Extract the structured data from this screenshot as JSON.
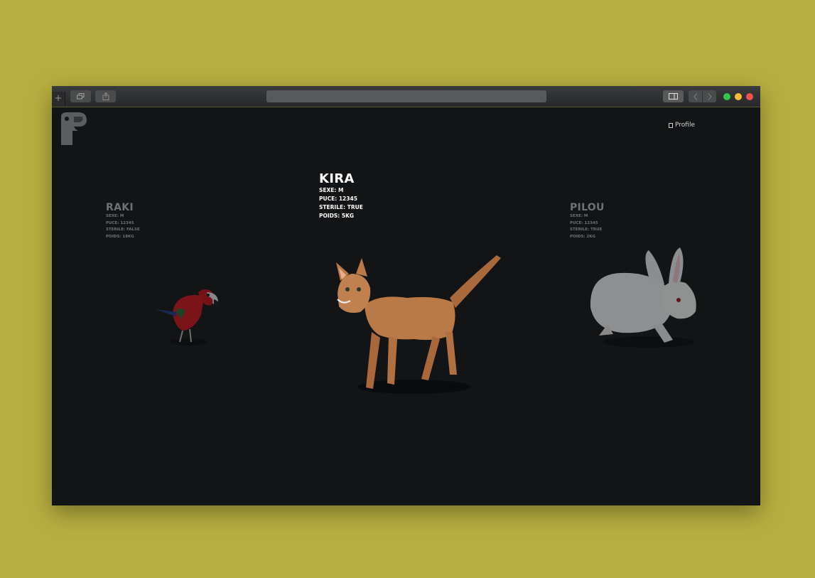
{
  "browser": {
    "new_tab_label": "+",
    "tabs_icon": "tabs-icon",
    "share_icon": "share-icon",
    "sidebar_icon": "sidebar-icon",
    "back_icon": "chevron-left-icon",
    "forward_icon": "chevron-right-icon",
    "traffic_lights": {
      "green": "#2fc84a",
      "yellow": "#f5be2d",
      "red": "#f0524b"
    }
  },
  "header": {
    "logo_icon": "parrot-logo-icon",
    "profile_label": "Profile",
    "profile_icon": "profile-icon"
  },
  "pets": [
    {
      "name": "RAKI",
      "sexe": "SEXE: M",
      "puce": "PUCE: 12345",
      "sterile": "STERILE: FALSE",
      "poids": "POIDS: 18KG",
      "species_icon": "parrot-icon"
    },
    {
      "name": "KIRA",
      "sexe": "SEXE: M",
      "puce": "PUCE: 12345",
      "sterile": "STERILE: TRUE",
      "poids": "POIDS: 5KG",
      "species_icon": "cat-icon"
    },
    {
      "name": "PILOU",
      "sexe": "SEXE: M",
      "puce": "PUCE: 12345",
      "sterile": "STERILE: TRUE",
      "poids": "POIDS: 2KG",
      "species_icon": "rabbit-icon"
    }
  ],
  "colors": {
    "page_background": "#b8ae40",
    "app_background": "#121416",
    "featured_text": "#ffffff",
    "dimmed_text": "#6f7173"
  }
}
